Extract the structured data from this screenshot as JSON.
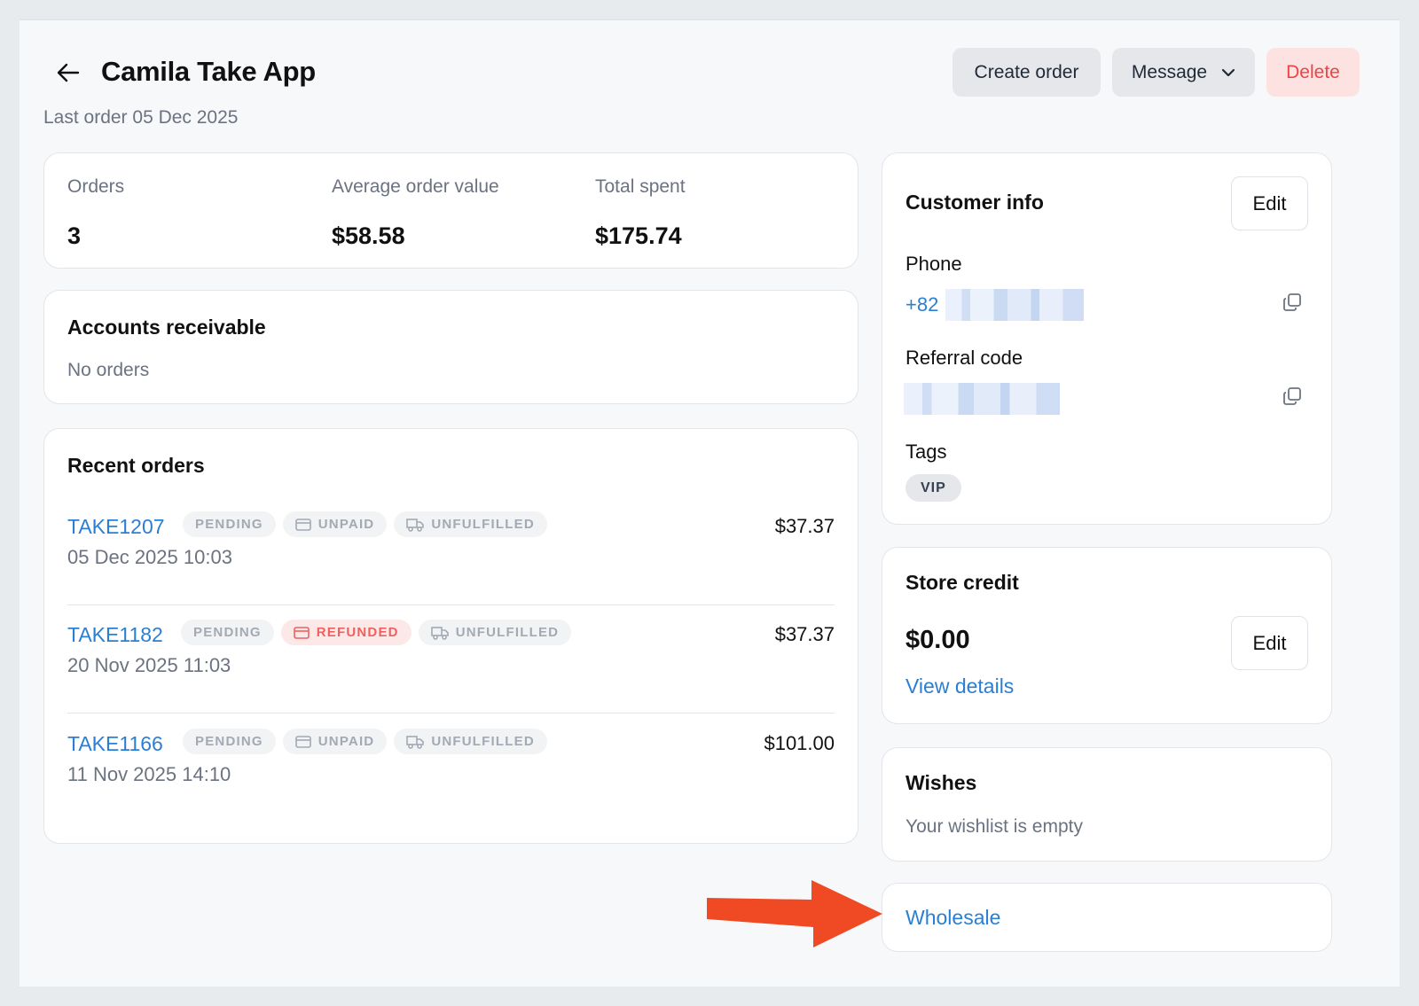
{
  "header": {
    "title": "Camila Take App",
    "subtitle": "Last order 05 Dec 2025",
    "actions": {
      "create_order": "Create order",
      "message": "Message",
      "delete": "Delete"
    }
  },
  "stats": [
    {
      "label": "Orders",
      "value": "3"
    },
    {
      "label": "Average order value",
      "value": "$58.58"
    },
    {
      "label": "Total spent",
      "value": "$175.74"
    }
  ],
  "accounts_receivable": {
    "title": "Accounts receivable",
    "empty": "No orders"
  },
  "recent_orders": {
    "title": "Recent orders",
    "rows": [
      {
        "id": "TAKE1207",
        "status": "PENDING",
        "payment": "UNPAID",
        "fulfillment": "UNFULFILLED",
        "date": "05 Dec 2025 10:03",
        "amount": "$37.37"
      },
      {
        "id": "TAKE1182",
        "status": "PENDING",
        "payment": "REFUNDED",
        "fulfillment": "UNFULFILLED",
        "date": "20 Nov 2025 11:03",
        "amount": "$37.37"
      },
      {
        "id": "TAKE1166",
        "status": "PENDING",
        "payment": "UNPAID",
        "fulfillment": "UNFULFILLED",
        "date": "11 Nov 2025 14:10",
        "amount": "$101.00"
      }
    ]
  },
  "customer_info": {
    "title": "Customer info",
    "edit": "Edit",
    "phone_label": "Phone",
    "phone_prefix": "+82",
    "referral_label": "Referral code",
    "tags_label": "Tags",
    "tags": [
      "VIP"
    ]
  },
  "store_credit": {
    "title": "Store credit",
    "value": "$0.00",
    "edit": "Edit",
    "view_details": "View details"
  },
  "wishes": {
    "title": "Wishes",
    "empty": "Your wishlist is empty"
  },
  "wholesale": {
    "label": "Wholesale"
  },
  "colors": {
    "link": "#2a7fd4",
    "danger": "#ef4444",
    "annotation_arrow": "#f04a24"
  }
}
